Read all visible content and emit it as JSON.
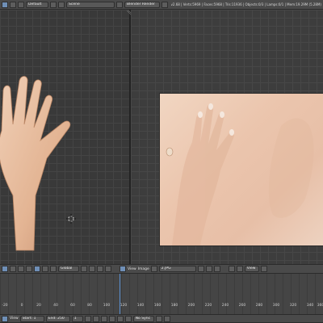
{
  "top_bar": {
    "layout_field": "Default",
    "scene_field": "Scene",
    "render_engine": "Blender Render",
    "stats": "v2.68 | Verts:5969 | Faces:5968 | Tris:11936 | Objects:0/3 | Lamps:0/1 | Mem:19.29M (5.28M)"
  },
  "viewport_header": {
    "orientation": "Global",
    "view_menu": "View",
    "image_menu": "Image",
    "image_field": "2.JPG",
    "view_btn": "View"
  },
  "timeline": {
    "ticks": [
      "-20",
      "0",
      "20",
      "40",
      "60",
      "80",
      "100",
      "120",
      "140",
      "160",
      "180",
      "200",
      "220",
      "240",
      "260",
      "280",
      "300",
      "320",
      "340",
      "360"
    ],
    "marker": "View",
    "start_label": "Start: 1",
    "end_label": "End: 250",
    "current_label": "1",
    "sync_label": "No Sync"
  }
}
